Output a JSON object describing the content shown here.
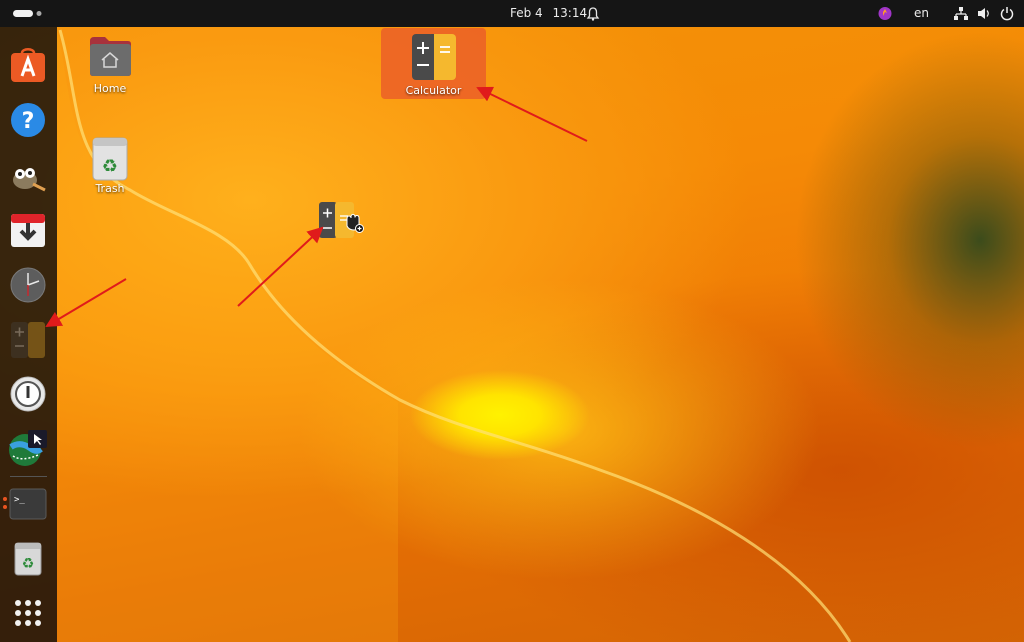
{
  "topbar": {
    "date": "Feb 4",
    "time": "13:14",
    "language": "en",
    "icons": [
      "workspace-indicator-icon",
      "notification-bell-icon",
      "color-picker-icon",
      "network-icon",
      "volume-icon",
      "power-icon"
    ]
  },
  "dock": {
    "items": [
      {
        "name": "App Center",
        "icon": "app-center-icon"
      },
      {
        "name": "Help",
        "icon": "help-icon"
      },
      {
        "name": "GIMP",
        "icon": "gimp-icon"
      },
      {
        "name": "Installer",
        "icon": "installer-icon"
      },
      {
        "name": "Clocks",
        "icon": "clock-icon"
      },
      {
        "name": "Calculator",
        "icon": "calculator-icon"
      },
      {
        "name": "Password Safe",
        "icon": "password-safe-icon"
      },
      {
        "name": "Screen Recorder",
        "icon": "screen-recorder-icon"
      },
      {
        "name": "Terminal",
        "icon": "terminal-icon"
      },
      {
        "name": "Trash",
        "icon": "trash-icon"
      },
      {
        "name": "Show Apps",
        "icon": "app-grid-icon"
      }
    ]
  },
  "desktop": {
    "home_label": "Home",
    "trash_label": "Trash",
    "calculator_label": "Calculator"
  },
  "colors": {
    "topbar": "#151515",
    "selection": "#e9602a",
    "arrow": "#e01b1b",
    "calc_yellow": "#f5b82e",
    "calc_dark": "#4a4a4a"
  }
}
